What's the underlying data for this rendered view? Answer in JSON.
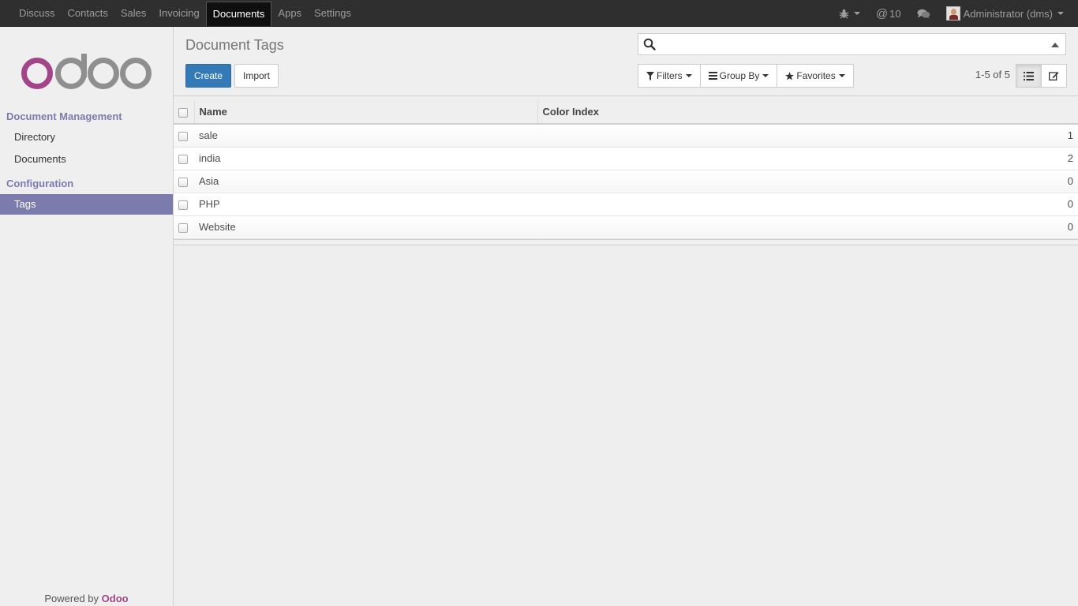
{
  "navbar": {
    "apps": [
      {
        "label": "Discuss"
      },
      {
        "label": "Contacts"
      },
      {
        "label": "Sales"
      },
      {
        "label": "Invoicing"
      },
      {
        "label": "Documents",
        "active": true
      },
      {
        "label": "Apps"
      },
      {
        "label": "Settings"
      }
    ],
    "mentions_count": "10",
    "user_name": "Administrator (dms)"
  },
  "sidebar": {
    "sections": [
      {
        "title": "Document Management",
        "items": [
          {
            "label": "Directory"
          },
          {
            "label": "Documents"
          }
        ]
      },
      {
        "title": "Configuration",
        "items": [
          {
            "label": "Tags",
            "active": true
          }
        ]
      }
    ],
    "powered_by_prefix": "Powered by",
    "powered_by_brand": "Odoo"
  },
  "control_panel": {
    "breadcrumb": "Document Tags",
    "create_label": "Create",
    "import_label": "Import",
    "search_placeholder": "",
    "filters_label": "Filters",
    "group_by_label": "Group By",
    "favorites_label": "Favorites",
    "pager": "1-5 of 5"
  },
  "table": {
    "columns": [
      "Name",
      "Color Index"
    ],
    "rows": [
      {
        "name": "sale",
        "color_index": "1"
      },
      {
        "name": "india",
        "color_index": "2"
      },
      {
        "name": "Asia",
        "color_index": "0"
      },
      {
        "name": "PHP",
        "color_index": "0"
      },
      {
        "name": "Website",
        "color_index": "0"
      }
    ]
  },
  "colors": {
    "navbar_bg": "#2f2f2f",
    "accent": "#7c7bad",
    "primary_button": "#337ab7",
    "brand": "#a24689"
  }
}
